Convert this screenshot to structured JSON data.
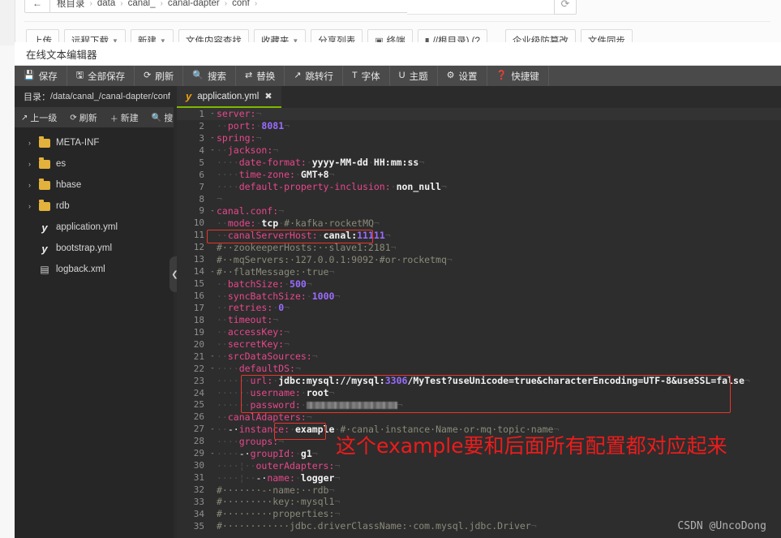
{
  "file_manager": {
    "back_icon": "arrow-left-icon",
    "refresh_icon": "refresh-icon",
    "breadcrumbs": [
      "根目录",
      "data",
      "canal_",
      "canal-dapter",
      "conf"
    ],
    "separator": "›",
    "toolbar": [
      {
        "label": "上传",
        "icon": "",
        "caret": false
      },
      {
        "label": "远程下载",
        "icon": "",
        "caret": true
      },
      {
        "label": "新建",
        "icon": "",
        "caret": true
      },
      {
        "label": "文件内容查找",
        "icon": "",
        "caret": false
      },
      {
        "label": "收藏夹",
        "icon": "",
        "caret": true
      },
      {
        "label": "分享列表",
        "icon": "",
        "caret": false
      },
      {
        "label": "终端",
        "icon": "terminal-icon",
        "caret": false
      },
      {
        "label": "//根目录) (?",
        "icon": "disk-icon",
        "caret": false
      },
      {
        "label": "企业级防篡改",
        "icon": "",
        "caret": false
      },
      {
        "label": "文件同步",
        "icon": "",
        "caret": false
      }
    ]
  },
  "editor": {
    "window_title": "在线文本编辑器",
    "toolbar": [
      {
        "icon": "save-icon",
        "glyph": "💾",
        "label": "保存"
      },
      {
        "icon": "save-all-icon",
        "glyph": "🖫",
        "label": "全部保存"
      },
      {
        "icon": "refresh-icon",
        "glyph": "⟳",
        "label": "刷新"
      },
      {
        "icon": "search-icon",
        "glyph": "🔍",
        "label": "搜索"
      },
      {
        "icon": "replace-icon",
        "glyph": "⇄",
        "label": "替换"
      },
      {
        "icon": "goto-line-icon",
        "glyph": "↗",
        "label": "跳转行"
      },
      {
        "icon": "font-icon",
        "glyph": "T",
        "label": "字体"
      },
      {
        "icon": "theme-icon",
        "glyph": "U",
        "label": "主题"
      },
      {
        "icon": "settings-icon",
        "glyph": "⚙",
        "label": "设置"
      },
      {
        "icon": "shortcuts-icon",
        "glyph": "❓",
        "label": "快捷键"
      }
    ],
    "sidebar": {
      "path_label": "目录：",
      "path_value": "/data/canal_/canal-dapter/conf",
      "tools": [
        {
          "icon": "up-level-icon",
          "glyph": "↗",
          "label": "上一级"
        },
        {
          "icon": "refresh-icon",
          "glyph": "⟳",
          "label": "刷新"
        },
        {
          "icon": "new-icon",
          "glyph": "＋",
          "label": "新建"
        },
        {
          "icon": "search-icon",
          "glyph": "🔍",
          "label": "搜索"
        }
      ],
      "tree": [
        {
          "name": "META-INF",
          "type": "folder",
          "arrow": "›"
        },
        {
          "name": "es",
          "type": "folder",
          "arrow": "›"
        },
        {
          "name": "hbase",
          "type": "folder",
          "arrow": "›"
        },
        {
          "name": "rdb",
          "type": "folder",
          "arrow": "›"
        },
        {
          "name": "application.yml",
          "type": "yml",
          "arrow": ""
        },
        {
          "name": "bootstrap.yml",
          "type": "yml",
          "arrow": ""
        },
        {
          "name": "logback.xml",
          "type": "xml",
          "arrow": ""
        }
      ]
    },
    "splitter_icon": "chevron-left-icon",
    "tab": {
      "icon": "yaml-file-icon",
      "label": "application.yml",
      "close": "✖"
    },
    "accent_color": "#7fb800",
    "highlight_color": "#e8352b"
  },
  "code": {
    "lines": [
      {
        "n": 1,
        "fold": "-",
        "active": true,
        "segs": [
          {
            "t": "k",
            "s": "server:"
          },
          {
            "t": "eol",
            "s": "¬"
          }
        ]
      },
      {
        "n": 2,
        "fold": "",
        "segs": [
          {
            "t": "ws",
            "s": "··"
          },
          {
            "t": "k",
            "s": "port:"
          },
          {
            "t": "ws",
            "s": "·"
          },
          {
            "t": "num",
            "s": "8081"
          },
          {
            "t": "eol",
            "s": "¬"
          }
        ]
      },
      {
        "n": 3,
        "fold": "-",
        "segs": [
          {
            "t": "k",
            "s": "spring:"
          },
          {
            "t": "eol",
            "s": "¬"
          }
        ]
      },
      {
        "n": 4,
        "fold": "-",
        "segs": [
          {
            "t": "ws",
            "s": "··"
          },
          {
            "t": "k",
            "s": "jackson:"
          },
          {
            "t": "eol",
            "s": "¬"
          }
        ]
      },
      {
        "n": 5,
        "fold": "",
        "segs": [
          {
            "t": "ws",
            "s": "····"
          },
          {
            "t": "k",
            "s": "date-format:"
          },
          {
            "t": "ws",
            "s": "·"
          },
          {
            "t": "v",
            "s": "yyyy-MM-dd"
          },
          {
            "t": "ws",
            "s": "·"
          },
          {
            "t": "v",
            "s": "HH:mm:ss"
          },
          {
            "t": "eol",
            "s": "¬"
          }
        ]
      },
      {
        "n": 6,
        "fold": "",
        "segs": [
          {
            "t": "ws",
            "s": "····"
          },
          {
            "t": "k",
            "s": "time-zone:"
          },
          {
            "t": "ws",
            "s": "·"
          },
          {
            "t": "v",
            "s": "GMT+8"
          },
          {
            "t": "eol",
            "s": "¬"
          }
        ]
      },
      {
        "n": 7,
        "fold": "",
        "segs": [
          {
            "t": "ws",
            "s": "····"
          },
          {
            "t": "k",
            "s": "default-property-inclusion:"
          },
          {
            "t": "ws",
            "s": "·"
          },
          {
            "t": "v",
            "s": "non_null"
          },
          {
            "t": "eol",
            "s": "¬"
          }
        ]
      },
      {
        "n": 8,
        "fold": "",
        "segs": [
          {
            "t": "eol",
            "s": "¬"
          }
        ]
      },
      {
        "n": 9,
        "fold": "-",
        "segs": [
          {
            "t": "k",
            "s": "canal.conf:"
          },
          {
            "t": "eol",
            "s": "¬"
          }
        ]
      },
      {
        "n": 10,
        "fold": "",
        "segs": [
          {
            "t": "ws",
            "s": "··"
          },
          {
            "t": "k",
            "s": "mode:"
          },
          {
            "t": "ws",
            "s": "·"
          },
          {
            "t": "v",
            "s": "tcp"
          },
          {
            "t": "ws",
            "s": "·"
          },
          {
            "t": "cm",
            "s": "#·kafka·rocketMQ"
          },
          {
            "t": "eol",
            "s": "¬"
          }
        ]
      },
      {
        "n": 11,
        "fold": "",
        "segs": [
          {
            "t": "ws",
            "s": "··"
          },
          {
            "t": "k",
            "s": "canalServerHost:"
          },
          {
            "t": "ws",
            "s": "·"
          },
          {
            "t": "v",
            "s": "canal:"
          },
          {
            "t": "num",
            "s": "11111"
          },
          {
            "t": "eol",
            "s": "¬"
          }
        ]
      },
      {
        "n": 12,
        "fold": "",
        "segs": [
          {
            "t": "cm",
            "s": "#··zookeeperHosts:··slave1:2181"
          },
          {
            "t": "eol",
            "s": "¬"
          }
        ]
      },
      {
        "n": 13,
        "fold": "",
        "segs": [
          {
            "t": "cm",
            "s": "#··mqServers:·127.0.0.1:9092·#or·rocketmq"
          },
          {
            "t": "eol",
            "s": "¬"
          }
        ]
      },
      {
        "n": 14,
        "fold": "-",
        "segs": [
          {
            "t": "cm",
            "s": "#··flatMessage:·true"
          },
          {
            "t": "eol",
            "s": "¬"
          }
        ]
      },
      {
        "n": 15,
        "fold": "",
        "segs": [
          {
            "t": "ws",
            "s": "··"
          },
          {
            "t": "k",
            "s": "batchSize:"
          },
          {
            "t": "ws",
            "s": "·"
          },
          {
            "t": "num",
            "s": "500"
          },
          {
            "t": "eol",
            "s": "¬"
          }
        ]
      },
      {
        "n": 16,
        "fold": "",
        "segs": [
          {
            "t": "ws",
            "s": "··"
          },
          {
            "t": "k",
            "s": "syncBatchSize:"
          },
          {
            "t": "ws",
            "s": "·"
          },
          {
            "t": "num",
            "s": "1000"
          },
          {
            "t": "eol",
            "s": "¬"
          }
        ]
      },
      {
        "n": 17,
        "fold": "",
        "segs": [
          {
            "t": "ws",
            "s": "··"
          },
          {
            "t": "k",
            "s": "retries:"
          },
          {
            "t": "ws",
            "s": "·"
          },
          {
            "t": "num",
            "s": "0"
          },
          {
            "t": "eol",
            "s": "¬"
          }
        ]
      },
      {
        "n": 18,
        "fold": "",
        "segs": [
          {
            "t": "ws",
            "s": "··"
          },
          {
            "t": "k",
            "s": "timeout:"
          },
          {
            "t": "eol",
            "s": "¬"
          }
        ]
      },
      {
        "n": 19,
        "fold": "",
        "segs": [
          {
            "t": "ws",
            "s": "··"
          },
          {
            "t": "k",
            "s": "accessKey:"
          },
          {
            "t": "eol",
            "s": "¬"
          }
        ]
      },
      {
        "n": 20,
        "fold": "",
        "segs": [
          {
            "t": "ws",
            "s": "··"
          },
          {
            "t": "k",
            "s": "secretKey:"
          },
          {
            "t": "eol",
            "s": "¬"
          }
        ]
      },
      {
        "n": 21,
        "fold": "-",
        "segs": [
          {
            "t": "ws",
            "s": "··"
          },
          {
            "t": "k",
            "s": "srcDataSources:"
          },
          {
            "t": "eol",
            "s": "¬"
          }
        ]
      },
      {
        "n": 22,
        "fold": "-",
        "segs": [
          {
            "t": "ws",
            "s": "····"
          },
          {
            "t": "k",
            "s": "defaultDS:"
          },
          {
            "t": "eol",
            "s": "¬"
          }
        ]
      },
      {
        "n": 23,
        "fold": "",
        "segs": [
          {
            "t": "ws",
            "s": "······"
          },
          {
            "t": "k",
            "s": "url:"
          },
          {
            "t": "ws",
            "s": "·"
          },
          {
            "t": "v",
            "s": "jdbc:mysql://mysql:"
          },
          {
            "t": "num",
            "s": "3306"
          },
          {
            "t": "v",
            "s": "/MyTest?useUnicode=true&characterEncoding=UTF-8&useSSL=false"
          },
          {
            "t": "eol",
            "s": "¬"
          }
        ]
      },
      {
        "n": 24,
        "fold": "",
        "segs": [
          {
            "t": "ws",
            "s": "······"
          },
          {
            "t": "k",
            "s": "username:"
          },
          {
            "t": "ws",
            "s": "·"
          },
          {
            "t": "v",
            "s": "root"
          },
          {
            "t": "eol",
            "s": "¬"
          }
        ]
      },
      {
        "n": 25,
        "fold": "",
        "masked": true,
        "segs": [
          {
            "t": "ws",
            "s": "······"
          },
          {
            "t": "k",
            "s": "password:"
          },
          {
            "t": "ws",
            "s": "·"
          }
        ]
      },
      {
        "n": 26,
        "fold": "",
        "segs": [
          {
            "t": "ws",
            "s": "··"
          },
          {
            "t": "k",
            "s": "canalAdapters:"
          },
          {
            "t": "eol",
            "s": "¬"
          }
        ]
      },
      {
        "n": 27,
        "fold": "-",
        "segs": [
          {
            "t": "ws",
            "s": "··"
          },
          {
            "t": "plain",
            "s": "-·"
          },
          {
            "t": "k",
            "s": "instance:"
          },
          {
            "t": "ws",
            "s": "·"
          },
          {
            "t": "v",
            "s": "example"
          },
          {
            "t": "ws",
            "s": "·"
          },
          {
            "t": "cm",
            "s": "#·canal·instance·Name·or·mq·topic·name"
          },
          {
            "t": "eol",
            "s": "¬"
          }
        ]
      },
      {
        "n": 28,
        "fold": "",
        "segs": [
          {
            "t": "ws",
            "s": "····"
          },
          {
            "t": "k",
            "s": "groups:"
          },
          {
            "t": "eol",
            "s": "¬"
          }
        ]
      },
      {
        "n": 29,
        "fold": "-",
        "segs": [
          {
            "t": "ws",
            "s": "····"
          },
          {
            "t": "plain",
            "s": "-·"
          },
          {
            "t": "k",
            "s": "groupId:"
          },
          {
            "t": "ws",
            "s": "·"
          },
          {
            "t": "v",
            "s": "g1"
          },
          {
            "t": "eol",
            "s": "¬"
          }
        ]
      },
      {
        "n": 30,
        "fold": "",
        "segs": [
          {
            "t": "ws",
            "s": "····¦··"
          },
          {
            "t": "k",
            "s": "outerAdapters:"
          },
          {
            "t": "eol",
            "s": "¬"
          }
        ]
      },
      {
        "n": 31,
        "fold": "",
        "segs": [
          {
            "t": "ws",
            "s": "····¦··"
          },
          {
            "t": "plain",
            "s": "-·"
          },
          {
            "t": "k",
            "s": "name:"
          },
          {
            "t": "ws",
            "s": "·"
          },
          {
            "t": "v",
            "s": "logger"
          },
          {
            "t": "eol",
            "s": "¬"
          }
        ]
      },
      {
        "n": 32,
        "fold": "",
        "segs": [
          {
            "t": "cm",
            "s": "#·······-·name:··rdb"
          },
          {
            "t": "eol",
            "s": "¬"
          }
        ]
      },
      {
        "n": 33,
        "fold": "",
        "segs": [
          {
            "t": "cm",
            "s": "#·········key:·mysql1"
          },
          {
            "t": "eol",
            "s": "¬"
          }
        ]
      },
      {
        "n": 34,
        "fold": "",
        "segs": [
          {
            "t": "cm",
            "s": "#·········properties:"
          },
          {
            "t": "eol",
            "s": "¬"
          }
        ]
      },
      {
        "n": 35,
        "fold": "",
        "segs": [
          {
            "t": "cm",
            "s": "#············jdbc.driverClassName:·com.mysql.jdbc.Driver"
          },
          {
            "t": "eol",
            "s": "¬"
          }
        ]
      }
    ],
    "annotations": {
      "note_text": "这个example要和后面所有配置都对应起来"
    }
  },
  "watermark": "CSDN @UncoDong"
}
